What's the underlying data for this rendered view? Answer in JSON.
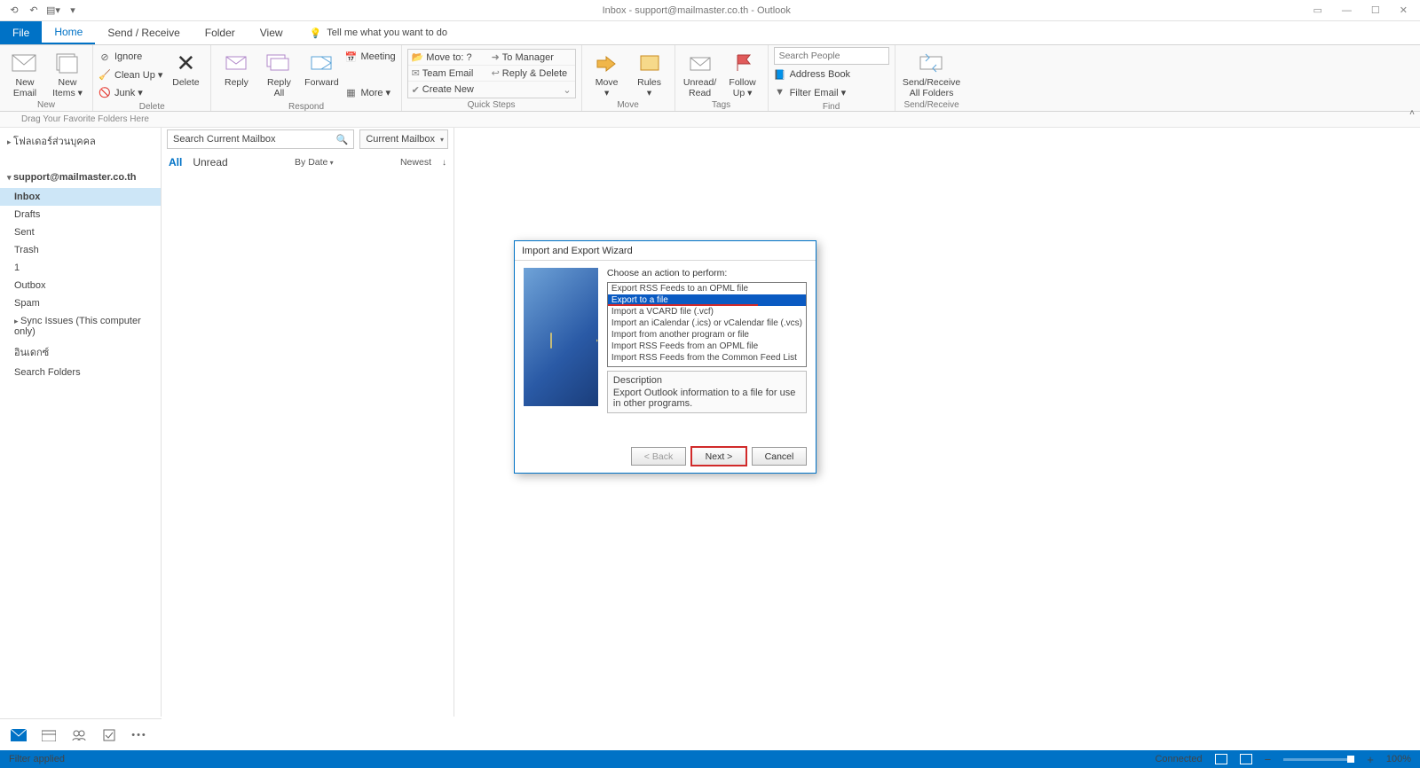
{
  "window": {
    "title": "Inbox - support@mailmaster.co.th - Outlook"
  },
  "tabs": {
    "file": "File",
    "home": "Home",
    "sendrecv": "Send / Receive",
    "folder": "Folder",
    "view": "View",
    "tell_placeholder": "Tell me what you want to do"
  },
  "ribbon": {
    "new": {
      "new_email": "New\nEmail",
      "new_items": "New\nItems ▾",
      "group": "New"
    },
    "delete": {
      "ignore": "Ignore",
      "cleanup": "Clean Up ▾",
      "junk": "Junk ▾",
      "delete": "Delete",
      "group": "Delete"
    },
    "respond": {
      "reply": "Reply",
      "replyall": "Reply\nAll",
      "forward": "Forward",
      "meeting": "Meeting",
      "more": "More ▾",
      "group": "Respond"
    },
    "quicksteps": {
      "moveto": "Move to: ?",
      "tomanager": "To Manager",
      "teamemail": "Team Email",
      "replydel": "Reply & Delete",
      "createnew": "Create New",
      "group": "Quick Steps"
    },
    "move": {
      "move": "Move\n▾",
      "rules": "Rules\n▾",
      "group": "Move"
    },
    "tags": {
      "unread": "Unread/\nRead",
      "follow": "Follow\nUp ▾",
      "group": "Tags"
    },
    "find": {
      "search_placeholder": "Search People",
      "address": "Address Book",
      "filter": "Filter Email ▾",
      "group": "Find"
    },
    "sendrecv_grp": {
      "btn": "Send/Receive\nAll Folders",
      "group": "Send/Receive"
    }
  },
  "favbar": "Drag Your Favorite Folders Here",
  "nav": {
    "favorites_header": "โฟลเดอร์ส่วนบุคคล",
    "account": "support@mailmaster.co.th",
    "folders": {
      "inbox": "Inbox",
      "drafts": "Drafts",
      "sent": "Sent",
      "trash": "Trash",
      "one": "1",
      "outbox": "Outbox",
      "spam": "Spam",
      "sync": "Sync Issues (This computer only)",
      "rss": "อินเดกซ์",
      "search": "Search Folders"
    }
  },
  "list": {
    "search_placeholder": "Search Current Mailbox",
    "scope": "Current Mailbox",
    "all": "All",
    "unread": "Unread",
    "bydate": "By Date",
    "newest": "Newest"
  },
  "switcher": {
    "dots": "•••"
  },
  "status": {
    "left": "Filter applied",
    "connected": "Connected",
    "zoom": "100%"
  },
  "dialog": {
    "title": "Import and Export Wizard",
    "choose": "Choose an action to perform:",
    "options": [
      "Export RSS Feeds to an OPML file",
      "Export to a file",
      "Import a VCARD file (.vcf)",
      "Import an iCalendar (.ics) or vCalendar file (.vcs)",
      "Import from another program or file",
      "Import RSS Feeds from an OPML file",
      "Import RSS Feeds from the Common Feed List"
    ],
    "desc_h": "Description",
    "desc_b": "Export Outlook information to a file for use in other programs.",
    "back": "< Back",
    "next": "Next >",
    "cancel": "Cancel"
  }
}
